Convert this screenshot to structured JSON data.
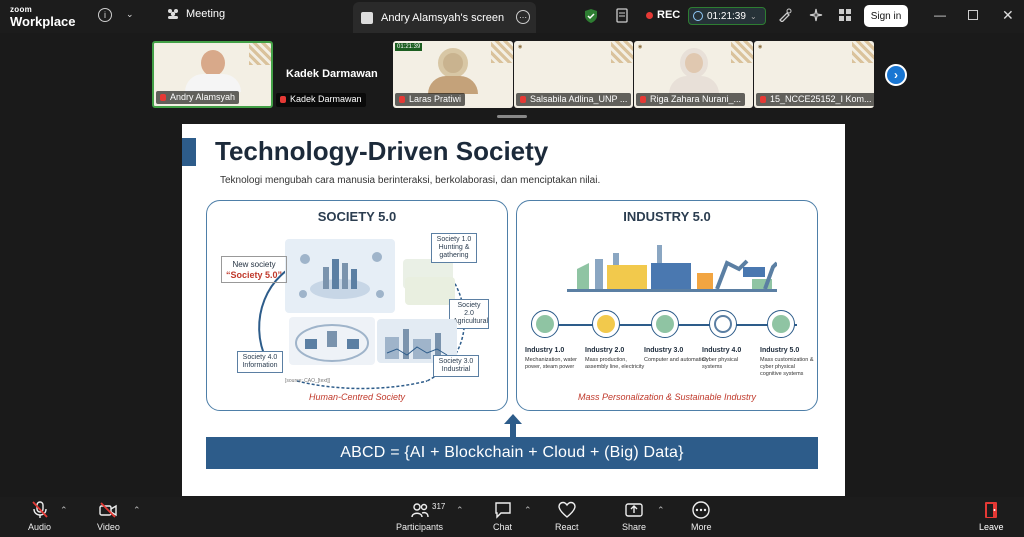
{
  "app": {
    "brand_top": "zoom",
    "brand_bottom": "Workplace"
  },
  "topbar": {
    "meeting_label": "Meeting",
    "tab_title": "Andry Alamsyah's screen",
    "rec_label": "REC",
    "timer": "01:21:39",
    "signin_label": "Sign in"
  },
  "gallery": {
    "participants": [
      {
        "name": "Andry Alamsyah"
      },
      {
        "name": "Kadek Darmawan"
      },
      {
        "name": "Laras Pratiwi"
      },
      {
        "name": "Salsabila Adlina_UNP ..."
      },
      {
        "name": "Riga Zahara Nurani_..."
      },
      {
        "name": "15_NCCE25152_I Kom..."
      }
    ],
    "kadek_label": "Kadek Darmawan",
    "mini_timer": "01:21:39"
  },
  "slide": {
    "title": "Technology-Driven Society",
    "subtitle": "Teknologi mengubah cara manusia berinteraksi, berkolaborasi, dan menciptakan nilai.",
    "society": {
      "title": "SOCIETY 5.0",
      "new_society_line1": "New society",
      "new_society_line2": "“Society 5.0”",
      "s1": "Society 1.0 Hunting & gathering",
      "s2": "Society 2.0 Agricultural",
      "s3": "Society 3.0 Industrial",
      "s4": "Society 4.0 Information",
      "source": "[source: CAO_[text]]",
      "footer": "Human-Centred Society"
    },
    "industry": {
      "title": "INDUSTRY 5.0",
      "stages": [
        {
          "label": "Industry 1.0",
          "desc": "Mechanization, water power, steam power"
        },
        {
          "label": "Industry 2.0",
          "desc": "Mass production, assembly line, electricity"
        },
        {
          "label": "Industry 3.0",
          "desc": "Computer and automation"
        },
        {
          "label": "Industry 4.0",
          "desc": "Cyber physical systems"
        },
        {
          "label": "Industry 5.0",
          "desc": "Mass customization & cyber physical cognitive systems"
        }
      ],
      "footer": "Mass Personalization & Sustainable Industry"
    },
    "formula": "ABCD = {AI + Blockchain + Cloud + (Big) Data}"
  },
  "toolbar": {
    "audio": "Audio",
    "video": "Video",
    "participants": "Participants",
    "participants_count": "317",
    "chat": "Chat",
    "react": "React",
    "share": "Share",
    "more": "More",
    "leave": "Leave"
  },
  "colors": {
    "accent": "#2d5c8a",
    "rec": "#e53935",
    "active_border": "#43a047",
    "leave": "#e53935"
  }
}
